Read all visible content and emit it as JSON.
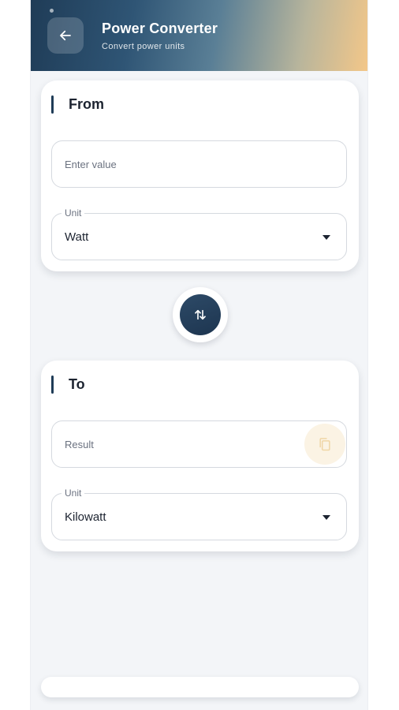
{
  "header": {
    "title": "Power Converter",
    "subtitle": "Convert power units",
    "back_icon": "arrow-left-icon"
  },
  "from": {
    "title": "From",
    "value_placeholder": "Enter value",
    "unit_label": "Unit",
    "unit_value": "Watt"
  },
  "swap": {
    "icon": "swap-vertical-icon"
  },
  "to": {
    "title": "To",
    "result_placeholder": "Result",
    "copy_icon": "copy-icon",
    "unit_label": "Unit",
    "unit_value": "Kilowatt"
  },
  "colors": {
    "primary": "#1f3c57",
    "accent": "#f3c789",
    "copy_bg": "#fbf3e4"
  }
}
